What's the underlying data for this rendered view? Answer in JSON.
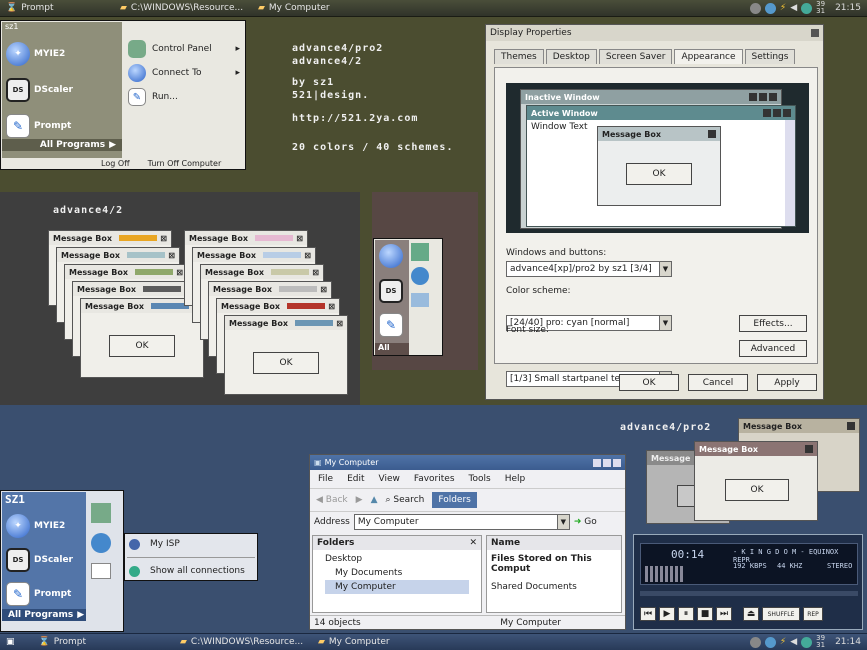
{
  "taskbar_top": {
    "start_label": "Prompt",
    "task1": "C:\\WINDOWS\\Resource...",
    "task2": "My Computer",
    "clock": "21:15",
    "date_top": "39",
    "date_bottom": "31"
  },
  "startmenu1": {
    "user": "sz1",
    "items": [
      "MYIE2",
      "DScaler",
      "Prompt"
    ],
    "all_programs": "All Programs",
    "right_items": [
      "Control Panel",
      "Connect To",
      "Run..."
    ],
    "log_off": "Log Off",
    "turn_off": "Turn Off Computer"
  },
  "info": {
    "line1": "advance4/pro2",
    "line2": "advance4/2",
    "line3": "by sz1",
    "line4": "521|design.",
    "line5": "http://521.2ya.com",
    "line6": "20 colors / 40 schemes."
  },
  "gray_panel": {
    "title": "advance4/2",
    "msgbox_title": "Message Box",
    "ok": "OK"
  },
  "plum_panel": {
    "all": "All"
  },
  "display_props": {
    "title": "Display Properties",
    "tabs": [
      "Themes",
      "Desktop",
      "Screen Saver",
      "Appearance",
      "Settings"
    ],
    "preview": {
      "inactive": "Inactive Window",
      "active": "Active Window",
      "window_text": "Window Text",
      "msgbox": "Message Box",
      "ok": "OK"
    },
    "label_windows": "Windows and buttons:",
    "value_windows": "advance4[xp]/pro2 by sz1 [3/4]",
    "label_scheme": "Color scheme:",
    "value_scheme": "[24/40] pro: cyan [normal]",
    "label_font": "Font size:",
    "value_font": "[1/3] Small startpanel text",
    "effects": "Effects...",
    "advanced": "Advanced",
    "ok": "OK",
    "cancel": "Cancel",
    "apply": "Apply"
  },
  "blue_label": "advance4/pro2",
  "msgboxes_right": {
    "title": "Message Box",
    "title_b": "Message B",
    "ok": "OK"
  },
  "startmenu2": {
    "user": "SZ1",
    "items": [
      "MYIE2",
      "DScaler",
      "Prompt"
    ],
    "all_programs": "All Programs",
    "sub_items": [
      "My ISP",
      "Show all connections"
    ]
  },
  "mycomputer": {
    "title": "My Computer",
    "menu": [
      "File",
      "Edit",
      "View",
      "Favorites",
      "Tools",
      "Help"
    ],
    "back": "Back",
    "search": "Search",
    "folders": "Folders",
    "address_label": "Address",
    "address_value": "My Computer",
    "go": "Go",
    "folders_header": "Folders",
    "tree": [
      "Desktop",
      "My Documents",
      "My Computer"
    ],
    "name_header": "Name",
    "group": "Files Stored on This Comput",
    "shared": "Shared Documents",
    "status_left": "14 objects",
    "status_right": "My Computer"
  },
  "player": {
    "time": "00:14",
    "track": "- K I N G D O M - EQUINOX REPR",
    "kbps": "192 KBPS",
    "khz": "44 KHZ",
    "stereo": "STEREO",
    "shuffle": "SHUFFLE",
    "rep": "REP"
  },
  "taskbar_bottom": {
    "start_label": "Prompt",
    "task1": "C:\\WINDOWS\\Resource...",
    "task2": "My Computer",
    "clock": "21:14",
    "date_top": "39",
    "date_bottom": "31"
  }
}
